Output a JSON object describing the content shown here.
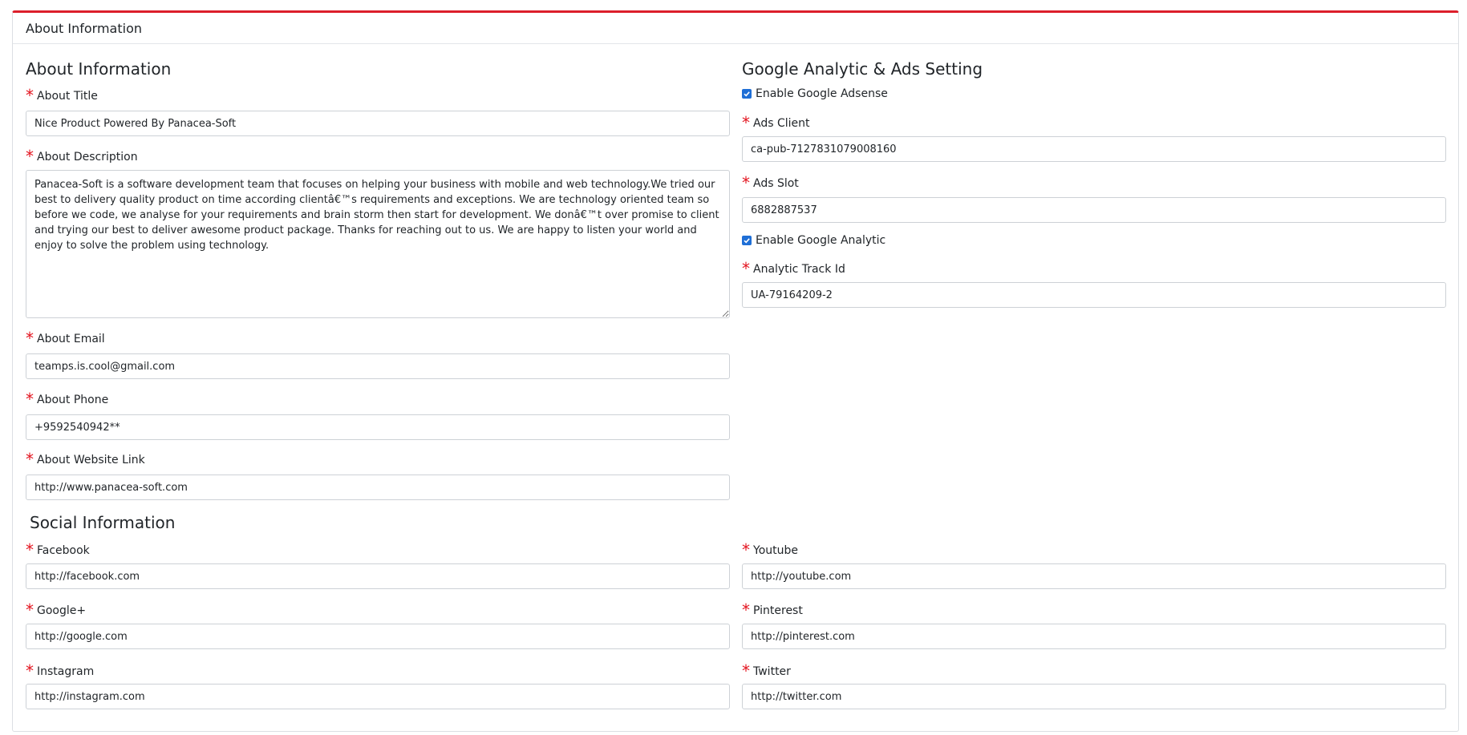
{
  "card": {
    "header_title": "About Information"
  },
  "about": {
    "section_title": "About Information",
    "title": {
      "label": "About Title",
      "value": "Nice Product Powered By Panacea-Soft"
    },
    "description": {
      "label": "About Description",
      "value": "Panacea-Soft is a software development team that focuses on helping your business with mobile and web technology.We tried our best to delivery quality product on time according clientâ€™s requirements and exceptions. We are technology oriented team so before we code, we analyse for your requirements and brain storm then start for development. We donâ€™t over promise to client and trying our best to deliver awesome product package. Thanks for reaching out to us. We are happy to listen your world and enjoy to solve the problem using technology."
    },
    "email": {
      "label": "About Email",
      "value": "teamps.is.cool@gmail.com"
    },
    "phone": {
      "label": "About Phone",
      "value": "+9592540942**"
    },
    "website": {
      "label": "About Website Link",
      "value": "http://www.panacea-soft.com"
    }
  },
  "google": {
    "section_title": "Google Analytic & Ads Setting",
    "adsense": {
      "label": "Enable Google Adsense",
      "checked": true
    },
    "ads_client": {
      "label": "Ads Client",
      "value": "ca-pub-7127831079008160"
    },
    "ads_slot": {
      "label": "Ads Slot",
      "value": "6882887537"
    },
    "analytic": {
      "label": "Enable Google Analytic",
      "checked": true
    },
    "track_id": {
      "label": "Analytic Track Id",
      "value": "UA-79164209-2"
    }
  },
  "social": {
    "section_title": "Social Information",
    "facebook": {
      "label": "Facebook",
      "value": "http://facebook.com"
    },
    "youtube": {
      "label": "Youtube",
      "value": "http://youtube.com"
    },
    "google_plus": {
      "label": "Google+",
      "value": "http://google.com"
    },
    "pinterest": {
      "label": "Pinterest",
      "value": "http://pinterest.com"
    },
    "instagram": {
      "label": "Instagram",
      "value": "http://instagram.com"
    },
    "twitter": {
      "label": "Twitter",
      "value": "http://twitter.com"
    }
  },
  "required_marker": "*",
  "colors": {
    "accent": "#dc1f2b",
    "required": "#e3141f",
    "checkbox": "#1f6fd6"
  },
  "icons": {
    "checkbox": "check-icon"
  }
}
